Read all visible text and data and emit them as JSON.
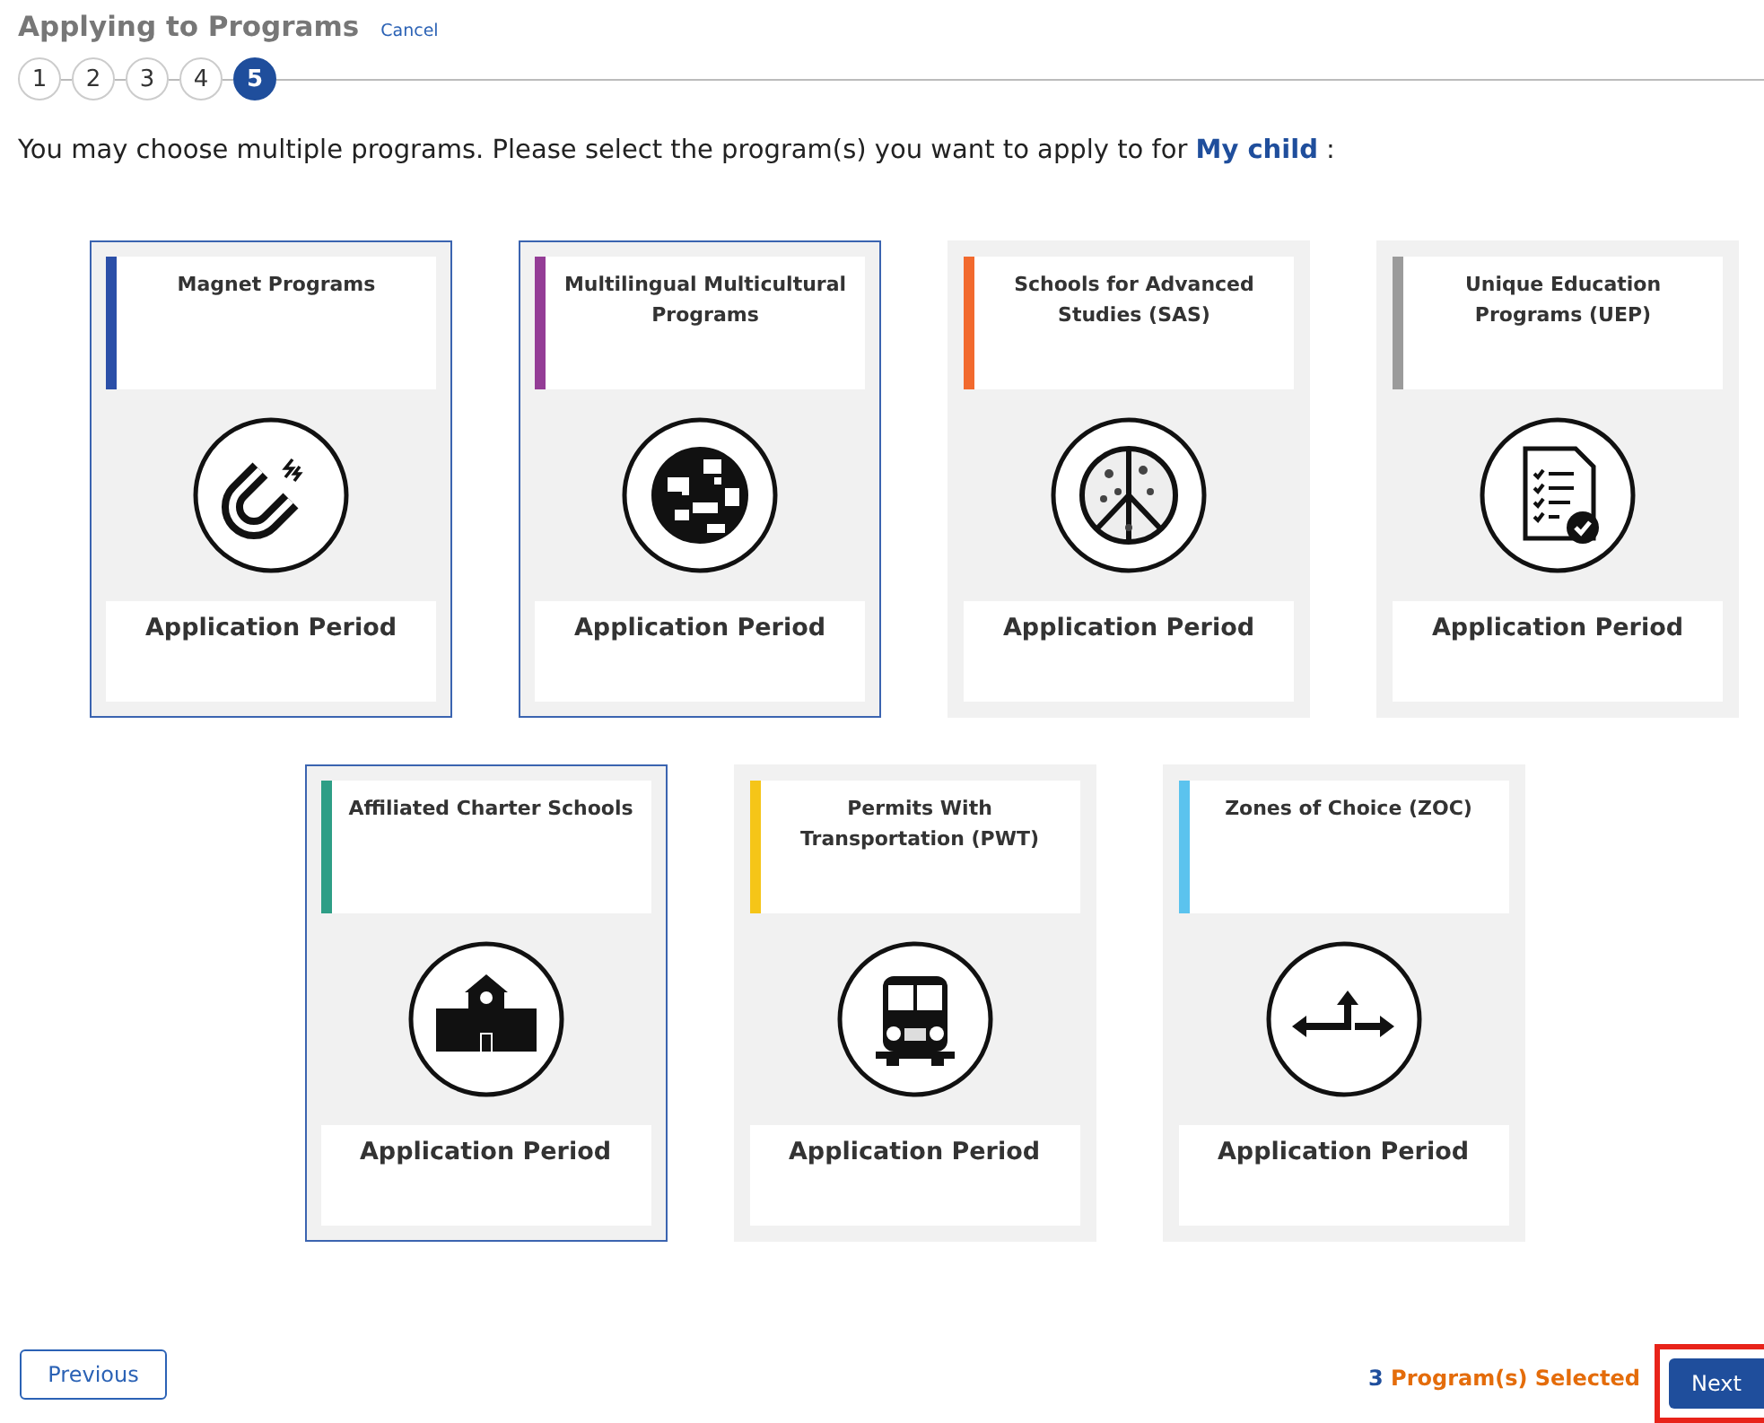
{
  "header": {
    "title": "Applying to Programs",
    "cancel_link": "Cancel"
  },
  "steps": [
    {
      "label": "1",
      "selected": false
    },
    {
      "label": "2",
      "selected": false
    },
    {
      "label": "3",
      "selected": false
    },
    {
      "label": "4",
      "selected": false
    },
    {
      "label": "5",
      "selected": true
    }
  ],
  "instruction": "You may choose multiple programs. Please select the program(s) you want to apply to for **My child** :",
  "program_rows": [
    {
      "cards": [
        {
          "title": "Magnet Programs",
          "color": "#2b4fa8",
          "selected": true,
          "period": "Application Period"
        },
        {
          "title": "Multilingual Multicultural Programs",
          "color": "#943d96",
          "selected": true,
          "period": "Application Period"
        },
        {
          "title": "Schools for Advanced Studies (SAS)",
          "color": "#f26a2e",
          "selected": false,
          "period": "Application Period"
        },
        {
          "title": "Unique Education Programs (UEP)",
          "color": "#9b9b9b",
          "selected": false,
          "period": "Application Period"
        }
      ]
    },
    {
      "cards": [
        {
          "title": "Affiliated Charter Schools",
          "color": "#2e9e86",
          "selected": true,
          "period": "Application Period"
        },
        {
          "title": "Permits With Transportation (PWT)",
          "color": "#f5c518",
          "selected": false,
          "period": "Application Period"
        },
        {
          "title": "Zones of Choice (ZOC)",
          "color": "#5bc3ee",
          "selected": false,
          "period": "Application Period"
        }
      ]
    }
  ],
  "footer": {
    "previous_button": "Previous",
    "selected_count": "3",
    "selected_label": "Program(s) Selected",
    "next_button": "Next",
    "next_highlighted": true
  }
}
